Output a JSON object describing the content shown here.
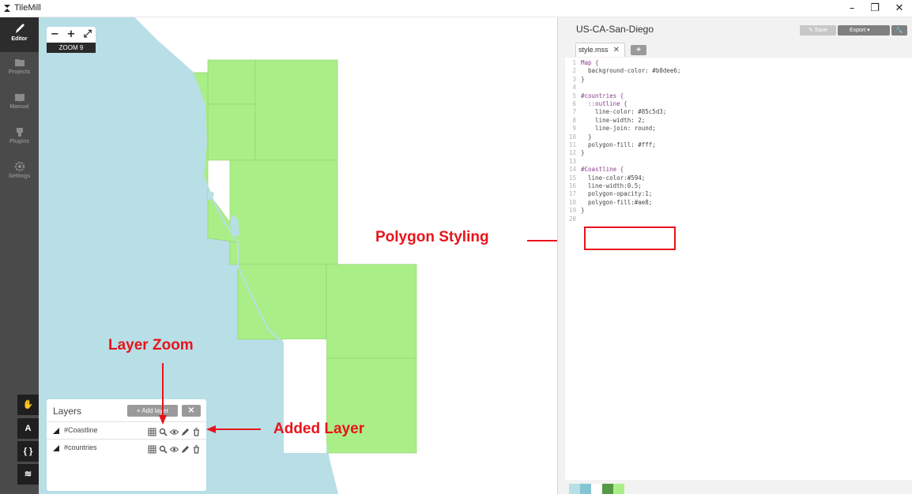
{
  "window": {
    "title": "TileMill",
    "controls": {
      "minimize": "–",
      "maximize": "❐",
      "close": "✕"
    }
  },
  "sidebar": {
    "items": [
      {
        "label": "Editor",
        "icon": "pencil-icon",
        "active": true
      },
      {
        "label": "Projects",
        "icon": "folder-icon",
        "active": false
      },
      {
        "label": "Manual",
        "icon": "book-icon",
        "active": false
      },
      {
        "label": "Plugins",
        "icon": "plug-icon",
        "active": false
      },
      {
        "label": "Settings",
        "icon": "gear-icon",
        "active": false
      }
    ],
    "tools": [
      {
        "name": "hand-tool-button",
        "icon": "hand-icon",
        "glyph": "✋"
      },
      {
        "name": "font-tool-button",
        "icon": "font-icon",
        "glyph": "A"
      },
      {
        "name": "carto-tool-button",
        "icon": "brackets-icon",
        "glyph": "{ }"
      },
      {
        "name": "layers-tool-button",
        "icon": "layers-icon",
        "glyph": "≋"
      }
    ]
  },
  "map": {
    "zoom": {
      "minus": "−",
      "plus": "+",
      "fullscreen": "⤢",
      "label": "ZOOM 9"
    },
    "water_color": "#b8dee6",
    "land_color": "#aaee88",
    "border_color": "#88c55f"
  },
  "layers_panel": {
    "title": "Layers",
    "add_layer": "+ Add layer",
    "close": "✕",
    "layers": [
      {
        "name": "#Coastline"
      },
      {
        "name": "#countries"
      }
    ]
  },
  "annotations": {
    "polygon_styling": "Polygon Styling",
    "layer_zoom": "Layer Zoom",
    "added_layer": "Added Layer",
    "color": "#e8141b"
  },
  "editor": {
    "project_title": "US-CA-San-Diego",
    "save": "Save",
    "export": "Export",
    "file_tab": "style.mss",
    "tab_close": "✕",
    "add_tab": "+",
    "code": [
      {
        "n": "1",
        "text": "Map {"
      },
      {
        "n": "2",
        "text": "  background-color: #b8dee6;"
      },
      {
        "n": "3",
        "text": "}"
      },
      {
        "n": "4",
        "text": ""
      },
      {
        "n": "5",
        "text": "#countries {"
      },
      {
        "n": "6",
        "text": "  ::outline {"
      },
      {
        "n": "7",
        "text": "    line-color: #85c5d3;"
      },
      {
        "n": "8",
        "text": "    line-width: 2;"
      },
      {
        "n": "9",
        "text": "    line-join: round;"
      },
      {
        "n": "10",
        "text": "  }"
      },
      {
        "n": "11",
        "text": "  polygon-fill: #fff;"
      },
      {
        "n": "12",
        "text": "}"
      },
      {
        "n": "13",
        "text": ""
      },
      {
        "n": "14",
        "text": "#Coastline {"
      },
      {
        "n": "15",
        "text": "  line-color:#594;"
      },
      {
        "n": "16",
        "text": "  line-width:0.5;"
      },
      {
        "n": "17",
        "text": "  polygon-opacity:1;"
      },
      {
        "n": "18",
        "text": "  polygon-fill:#ae8;"
      },
      {
        "n": "19",
        "text": "}"
      },
      {
        "n": "20",
        "text": ""
      }
    ],
    "palette": [
      "#b8dee6",
      "#85c5d3",
      "#ffffff",
      "#559944",
      "#aaee88"
    ]
  }
}
